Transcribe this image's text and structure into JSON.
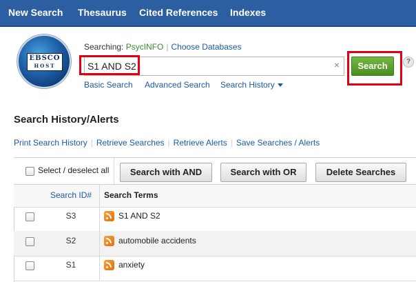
{
  "nav": {
    "items": [
      "New Search",
      "Thesaurus",
      "Cited References",
      "Indexes"
    ]
  },
  "logo": {
    "line1": "EBSCO",
    "line2": "HOST"
  },
  "search": {
    "searching_label": "Searching:",
    "database": "PsycINFO",
    "choose_databases": "Choose Databases",
    "query": "S1 AND S2",
    "clear": "×",
    "search_button": "Search",
    "help": "?",
    "basic_search": "Basic Search",
    "advanced_search": "Advanced Search",
    "search_history": "Search History"
  },
  "history": {
    "title": "Search History/Alerts",
    "links": [
      "Print Search History",
      "Retrieve Searches",
      "Retrieve Alerts",
      "Save Searches / Alerts"
    ],
    "select_all": "Select / deselect all",
    "buttons": [
      "Search with AND",
      "Search with OR",
      "Delete Searches"
    ],
    "columns": {
      "id": "Search ID#",
      "terms": "Search Terms"
    },
    "rows": [
      {
        "id": "S3",
        "terms": "S1 AND S2"
      },
      {
        "id": "S2",
        "terms": "automobile accidents"
      },
      {
        "id": "S1",
        "terms": "anxiety"
      }
    ]
  },
  "colors": {
    "nav_bg": "#2c5fa1",
    "search_button": "#5a9e2a",
    "highlight": "#e00010",
    "link": "#1a5aa8",
    "rss": "#f08a1c"
  }
}
